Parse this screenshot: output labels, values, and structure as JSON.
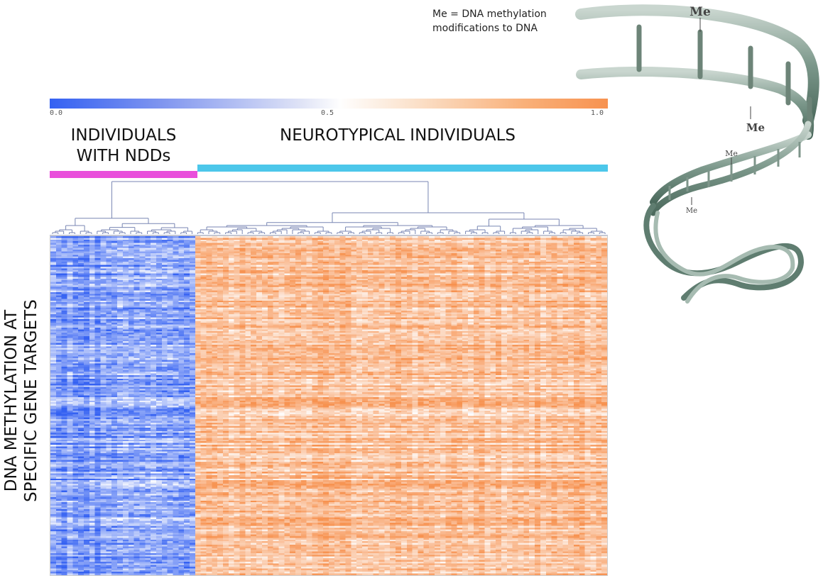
{
  "caption": {
    "line1": "Me = DNA methylation",
    "line2": "modifications to DNA"
  },
  "colorbar": {
    "ticks": [
      "0.0",
      "0.5",
      "1.0"
    ],
    "colors": {
      "low": "#3461f2",
      "mid": "#fefefe",
      "high": "#f79250"
    }
  },
  "groups": {
    "ndd": {
      "line1": "INDIVIDUALS",
      "line2": "WITH NDDs",
      "color": "#e94fdb"
    },
    "neurotypical": {
      "label": "NEUROTYPICAL INDIVIDUALS",
      "color": "#4cc7ea"
    }
  },
  "y_axis": {
    "line1": "DNA METHYLATION AT",
    "line2": "SPECIFIC GENE TARGETS"
  },
  "dna_labels": {
    "me": "Me"
  },
  "chart_data": {
    "type": "heatmap",
    "value_range": [
      0,
      1
    ],
    "groups": [
      {
        "name": "INDIVIDUALS WITH NDDs",
        "n_samples": 26,
        "mean_methylation": 0.2
      },
      {
        "name": "NEUROTYPICAL INDIVIDUALS",
        "n_samples": 74,
        "mean_methylation": 0.78
      }
    ],
    "n_rows": 200,
    "dendrogram": true
  }
}
